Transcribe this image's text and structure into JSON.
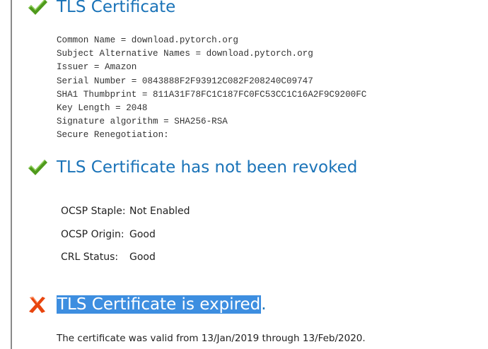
{
  "certificate": {
    "title": "TLS Certificate",
    "status": "ok",
    "details": [
      "Common Name = download.pytorch.org",
      "Subject Alternative Names = download.pytorch.org",
      "Issuer = Amazon",
      "Serial Number = 0843888F2F93912C082F208240C09747",
      "SHA1 Thumbprint = 811A31F78FC1C187FC0FC53CC1C16A2F9C9200FC",
      "Key Length = 2048",
      "Signature algorithm = SHA256-RSA",
      "Secure Renegotiation:"
    ]
  },
  "revocation": {
    "title": "TLS Certificate has not been revoked",
    "status": "ok",
    "rows": [
      {
        "label": "OCSP Staple:",
        "value": "Not Enabled"
      },
      {
        "label": "OCSP Origin:",
        "value": "Good"
      },
      {
        "label": "CRL Status:",
        "value": "Good"
      }
    ]
  },
  "expiry": {
    "title_selected": "TLS Certificate is expired",
    "title_tail": ".",
    "status": "error",
    "validity_text": "The certificate was valid from 13/Jan/2019 through 13/Feb/2020."
  },
  "colors": {
    "heading": "#1a73b8",
    "check": "#4f9a1c",
    "error": "#e8450e",
    "selection": "#3d8ee0"
  },
  "icons": {
    "ok": "check-mark-icon",
    "error": "x-mark-icon"
  }
}
